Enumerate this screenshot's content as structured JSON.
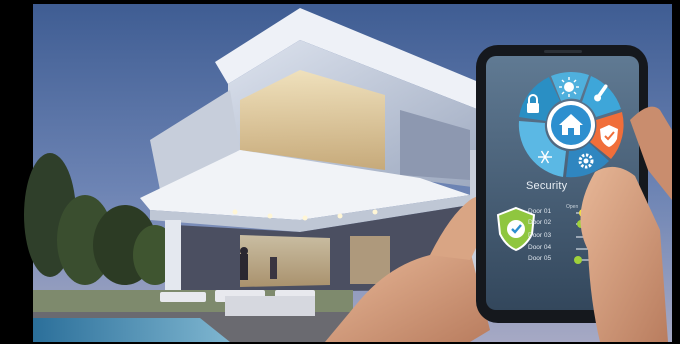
{
  "scene": {
    "description_hidden": "",
    "app": {
      "title": "Security",
      "open_label": "Open",
      "doors": [
        {
          "label": "Door 01",
          "status_color": "#f2e33b"
        },
        {
          "label": "Door 02",
          "status_color": "#9fd13b"
        },
        {
          "label": "Door 03",
          "status_color": "#e0242b"
        },
        {
          "label": "Door 04",
          "status_color": "#e0242b"
        },
        {
          "label": "Door 05",
          "status_color": "#9fd13b"
        }
      ],
      "wheel_segments": [
        {
          "icon": "lock-icon",
          "color": "#2a8fc4"
        },
        {
          "icon": "sun-icon",
          "color": "#4fb0dd"
        },
        {
          "icon": "thermometer-icon",
          "color": "#3ea6d9"
        },
        {
          "icon": "shield-icon",
          "color": "#f06e3a"
        },
        {
          "icon": "gear-icon",
          "color": "#2f86c0"
        },
        {
          "icon": "snowflake-icon",
          "color": "#5bb8e4"
        }
      ],
      "center_icon": "home-icon",
      "badge_icon": "shield-check-icon",
      "accent_color": "#2d8fcf",
      "badge_color": "#8fc63f"
    }
  }
}
